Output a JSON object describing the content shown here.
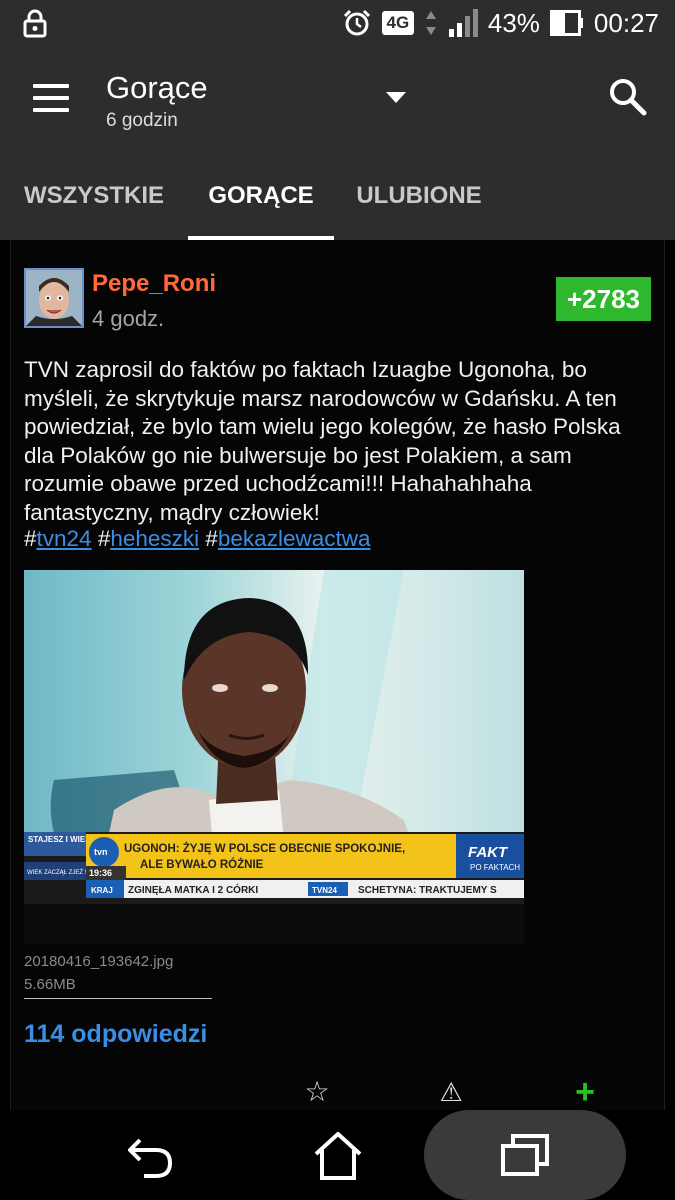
{
  "status_bar": {
    "network": "4G",
    "battery": "43%",
    "time": "00:27"
  },
  "app_bar": {
    "title": "Gorące",
    "subtitle": "6 godzin"
  },
  "tabs": [
    {
      "label": "WSZYSTKIE",
      "active": false
    },
    {
      "label": "GORĄCE",
      "active": true
    },
    {
      "label": "ULUBIONE",
      "active": false
    }
  ],
  "post": {
    "username": "Pepe_Roni",
    "time": "4 godz.",
    "score": "+2783",
    "text": "TVN zaprosil do faktów po faktach Izuagbe Ugonoha, bo myśleli, że skrytykuje marsz narodowców w Gdańsku. A ten powiedział, że bylo tam wielu jego kolegów, że hasło Polska dla Polaków go nie bulwersuje bo jest Polakiem, a sam rozumie obawe przed uchodźcami!!! Hahahahhaha fantastyczny, mądry człowiek!",
    "tags": [
      "tvn24",
      "heheszki",
      "bekazlewactwa"
    ],
    "attachment": {
      "filename": "20180416_193642.jpg",
      "size": "5.66MB",
      "tv_overlay": {
        "left_top": "STAJESZ I WIESZ",
        "left_bottom": "WIEK ZACZĄŁ ZJEŹ SŁOŃCE",
        "headline_1": "UGONOH: ŻYJĘ W POLSCE OBECNIE SPOKOJNIE,",
        "headline_2": "ALE BYWAŁO RÓŻNIE",
        "show_logo": "FAKT",
        "show_sub": "PO FAKTACH",
        "clock": "19:36",
        "ticker_tag": "KRAJ",
        "ticker_1": "ZGINĘŁA MATKA I 2 CÓRKI",
        "ticker_brand": "TVN24",
        "ticker_2": "SCHETYNA: TRAKTUJEMY S"
      }
    },
    "replies": "114 odpowiedzi"
  },
  "colors": {
    "bar_bg": "#2b2d2f",
    "username": "#ff6a3c",
    "score_bg": "#2eb82e",
    "link": "#3a8ee6",
    "add": "#23c423"
  },
  "icons": {
    "menu": "menu-icon",
    "search": "search-icon",
    "dropdown": "chevron-down-icon",
    "star": "star-icon",
    "report": "warning-icon",
    "add": "plus-icon",
    "back": "back-icon",
    "home": "home-icon",
    "recents": "recents-icon"
  }
}
